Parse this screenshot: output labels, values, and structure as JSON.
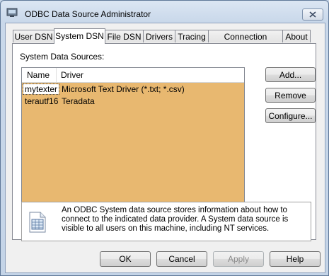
{
  "window": {
    "title": "ODBC Data Source Administrator",
    "close_icon": "close-icon",
    "app_icon": "odbc-app-icon"
  },
  "tabs": [
    {
      "label": "User DSN"
    },
    {
      "label": "System DSN",
      "active": true
    },
    {
      "label": "File DSN"
    },
    {
      "label": "Drivers"
    },
    {
      "label": "Tracing"
    },
    {
      "label": "Connection Pooling"
    },
    {
      "label": "About"
    }
  ],
  "panel": {
    "section_label": "System Data Sources:",
    "columns": [
      "Name",
      "Driver"
    ],
    "rows": [
      {
        "name": "mytexter",
        "driver": "Microsoft Text Driver (*.txt; *.csv)",
        "selected": true
      },
      {
        "name": "terautf16",
        "driver": "Teradata",
        "selected": false
      }
    ],
    "list_background": "#e8b870",
    "buttons": {
      "add": "Add...",
      "remove": "Remove",
      "configure": "Configure..."
    },
    "info_text": "An ODBC System data source stores information about how to connect to the indicated data provider.   A System data source is visible to all users on this machine, including NT services.",
    "info_icon": "data-source-icon"
  },
  "footer": {
    "ok": "OK",
    "cancel": "Cancel",
    "apply": "Apply",
    "help": "Help"
  }
}
